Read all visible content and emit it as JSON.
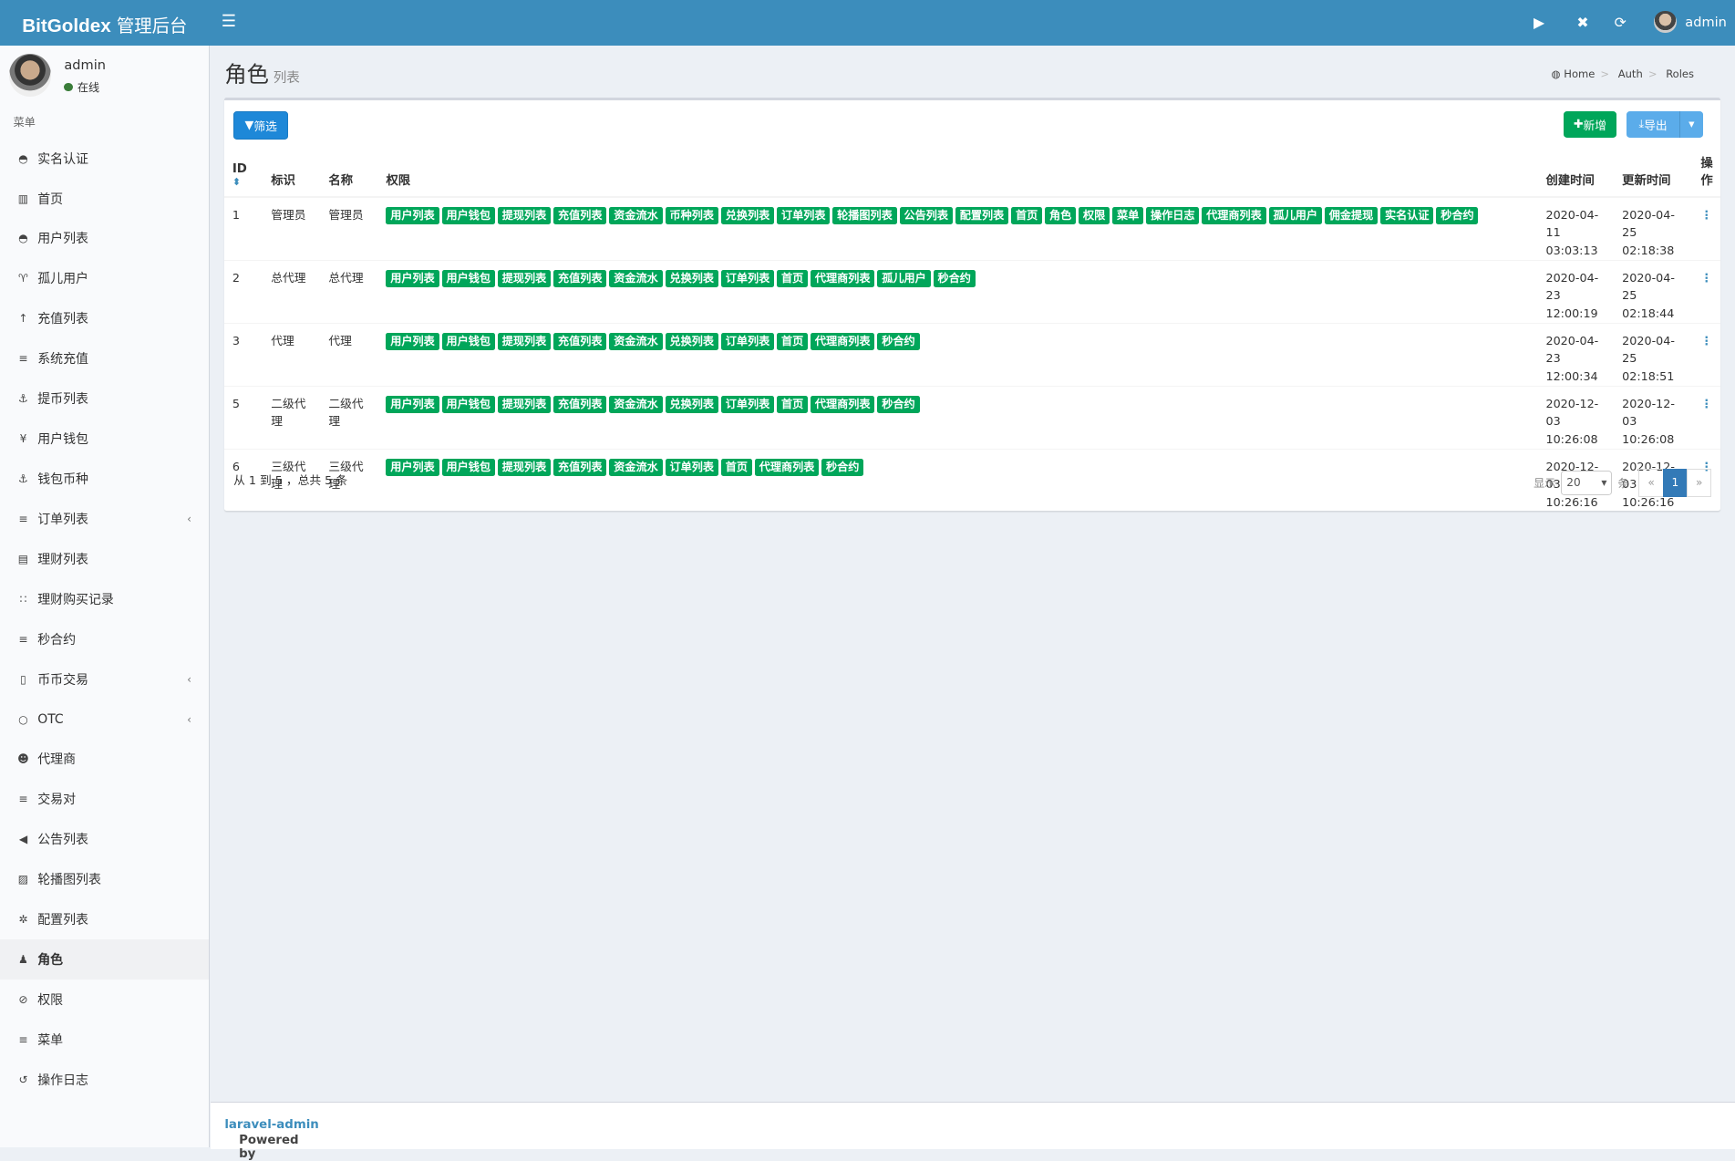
{
  "header": {
    "brand_bold": "BitGoldex",
    "brand_rest": " 管理后台",
    "user": "admin"
  },
  "sidebar": {
    "user": "admin",
    "status": "在线",
    "menu_header": "菜单",
    "items": [
      {
        "label": "实名认证",
        "icon": "◓"
      },
      {
        "label": "首页",
        "icon": "▥"
      },
      {
        "label": "用户列表",
        "icon": "◓"
      },
      {
        "label": "孤儿用户",
        "icon": "♈"
      },
      {
        "label": "充值列表",
        "icon": "↑"
      },
      {
        "label": "系统充值",
        "icon": "≡"
      },
      {
        "label": "提币列表",
        "icon": "⚓"
      },
      {
        "label": "用户钱包",
        "icon": "¥"
      },
      {
        "label": "钱包币种",
        "icon": "⚓"
      },
      {
        "label": "订单列表",
        "icon": "≡",
        "chevron": true
      },
      {
        "label": "理财列表",
        "icon": "▤"
      },
      {
        "label": "理财购买记录",
        "icon": "∷"
      },
      {
        "label": "秒合约",
        "icon": "≡"
      },
      {
        "label": "币币交易",
        "icon": "▯",
        "chevron": true
      },
      {
        "label": "OTC",
        "icon": "○",
        "chevron": true
      },
      {
        "label": "代理商",
        "icon": "☻"
      },
      {
        "label": "交易对",
        "icon": "≡"
      },
      {
        "label": "公告列表",
        "icon": "◀"
      },
      {
        "label": "轮播图列表",
        "icon": "▨"
      },
      {
        "label": "配置列表",
        "icon": "✲"
      },
      {
        "label": "角色",
        "icon": "♟",
        "active": true
      },
      {
        "label": "权限",
        "icon": "⊘"
      },
      {
        "label": "菜单",
        "icon": "≡"
      },
      {
        "label": "操作日志",
        "icon": "↺"
      }
    ]
  },
  "page": {
    "title": "角色",
    "subtitle": "列表",
    "breadcrumb": [
      "Home",
      "Auth",
      "Roles"
    ]
  },
  "toolbar": {
    "filter": "筛选",
    "add": "新增",
    "export": "导出"
  },
  "table": {
    "headers": {
      "id": "ID",
      "slug": "标识",
      "name": "名称",
      "perms": "权限",
      "created": "创建时间",
      "updated": "更新时间",
      "action": "操作"
    },
    "rows": [
      {
        "id": "1",
        "slug": "管理员",
        "name": "管理员",
        "perms": [
          "用户列表",
          "用户钱包",
          "提现列表",
          "充值列表",
          "资金流水",
          "币种列表",
          "兑换列表",
          "订单列表",
          "轮播图列表",
          "公告列表",
          "配置列表",
          "首页",
          "角色",
          "权限",
          "菜单",
          "操作日志",
          "代理商列表",
          "孤儿用户",
          "佣金提现",
          "实名认证",
          "秒合约"
        ],
        "created": [
          "2020-04-11",
          "03:03:13"
        ],
        "updated": [
          "2020-04-25",
          "02:18:38"
        ]
      },
      {
        "id": "2",
        "slug": "总代理",
        "name": "总代理",
        "perms": [
          "用户列表",
          "用户钱包",
          "提现列表",
          "充值列表",
          "资金流水",
          "兑换列表",
          "订单列表",
          "首页",
          "代理商列表",
          "孤儿用户",
          "秒合约"
        ],
        "created": [
          "2020-04-23",
          "12:00:19"
        ],
        "updated": [
          "2020-04-25",
          "02:18:44"
        ]
      },
      {
        "id": "3",
        "slug": "代理",
        "name": "代理",
        "perms": [
          "用户列表",
          "用户钱包",
          "提现列表",
          "充值列表",
          "资金流水",
          "兑换列表",
          "订单列表",
          "首页",
          "代理商列表",
          "秒合约"
        ],
        "created": [
          "2020-04-23",
          "12:00:34"
        ],
        "updated": [
          "2020-04-25",
          "02:18:51"
        ]
      },
      {
        "id": "5",
        "slug": "二级代理",
        "name": "二级代理",
        "perms": [
          "用户列表",
          "用户钱包",
          "提现列表",
          "充值列表",
          "资金流水",
          "兑换列表",
          "订单列表",
          "首页",
          "代理商列表",
          "秒合约"
        ],
        "created": [
          "2020-12-03",
          "10:26:08"
        ],
        "updated": [
          "2020-12-03",
          "10:26:08"
        ]
      },
      {
        "id": "6",
        "slug": "三级代理",
        "name": "三级代理",
        "perms": [
          "用户列表",
          "用户钱包",
          "提现列表",
          "充值列表",
          "资金流水",
          "订单列表",
          "首页",
          "代理商列表",
          "秒合约"
        ],
        "created": [
          "2020-12-03",
          "10:26:16"
        ],
        "updated": [
          "2020-12-03",
          "10:26:16"
        ]
      }
    ]
  },
  "pagination": {
    "summary": "从 1 到 5 ，总共 5 条",
    "show": "显示",
    "per_page": "20",
    "unit": "条",
    "prev": "«",
    "current": "1",
    "next": "»"
  },
  "footer": {
    "powered": "Powered by ",
    "link": "laravel-admin"
  },
  "colors": {
    "topbar": "#3c8dbc",
    "tag": "#00a65a",
    "filter": "#1e88d8"
  }
}
